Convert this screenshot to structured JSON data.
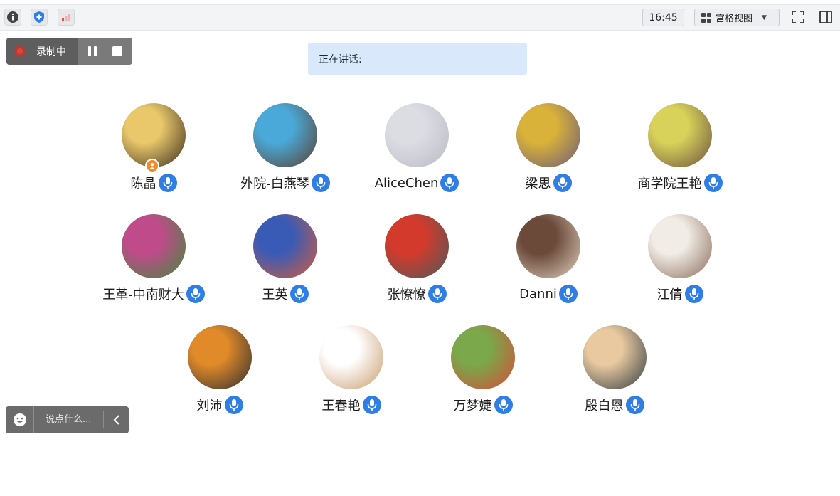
{
  "toolbar": {
    "time": "16:45",
    "view_mode": "宫格视图",
    "left_icons": [
      "info-icon",
      "shield-icon",
      "signal-icon"
    ],
    "right_icons": [
      "fullscreen-icon",
      "sidebar-toggle-icon"
    ]
  },
  "recording": {
    "label": "录制中"
  },
  "speaking": {
    "label": "正在讲话:"
  },
  "participants": [
    {
      "name": "陈晶",
      "host": true,
      "colors": [
        "#e8c86a",
        "#3b2a1e"
      ]
    },
    {
      "name": "外院-白燕琴",
      "colors": [
        "#4aa9d8",
        "#5a3d2b"
      ]
    },
    {
      "name": "AliceChen",
      "colors": [
        "#dcdde3",
        "#b9b9c4"
      ]
    },
    {
      "name": "梁思",
      "colors": [
        "#d9b23a",
        "#6a5a78"
      ]
    },
    {
      "name": "商学院王艳",
      "colors": [
        "#d8d25a",
        "#6b5040"
      ]
    },
    {
      "name": "王革-中南财大",
      "colors": [
        "#c04b8a",
        "#3f8a3a"
      ]
    },
    {
      "name": "王英",
      "colors": [
        "#3a5bb5",
        "#d65c3a"
      ]
    },
    {
      "name": "张憭憭",
      "colors": [
        "#d43a2c",
        "#4a5a5a"
      ]
    },
    {
      "name": "Danni",
      "colors": [
        "#6b4a3a",
        "#e0d2c0"
      ]
    },
    {
      "name": "江倩",
      "colors": [
        "#f1ece6",
        "#8a6a58"
      ]
    },
    {
      "name": "刘沛",
      "colors": [
        "#e08a2a",
        "#2b2b30"
      ]
    },
    {
      "name": "王春艳",
      "colors": [
        "#ffffff",
        "#c99a6a"
      ]
    },
    {
      "name": "万梦婕",
      "colors": [
        "#7aa84a",
        "#d84a3a"
      ]
    },
    {
      "name": "殷白恩",
      "colors": [
        "#e8c9a0",
        "#2f3a40"
      ]
    }
  ],
  "chat": {
    "placeholder": "说点什么..."
  }
}
